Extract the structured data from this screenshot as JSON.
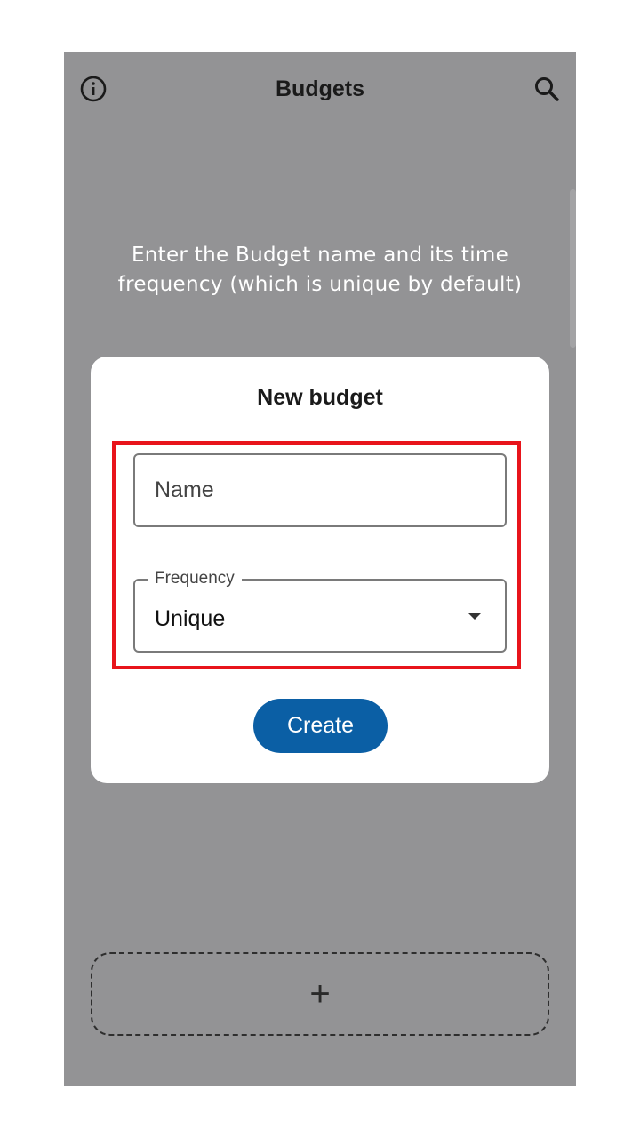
{
  "header": {
    "title": "Budgets",
    "info_icon": "info-icon",
    "search_icon": "search-icon"
  },
  "hint_text": "Enter the Budget name and its time frequency (which is unique by default)",
  "dialog": {
    "title": "New budget",
    "name_field": {
      "placeholder": "Name",
      "value": ""
    },
    "frequency_field": {
      "label": "Frequency",
      "value": "Unique",
      "dropdown_icon": "arrow-drop-down-icon"
    },
    "create_label": "Create"
  },
  "add_card": {
    "icon": "plus-icon",
    "symbol": "+"
  },
  "colors": {
    "overlay_background": "#939395",
    "dialog_background": "#ffffff",
    "primary_button": "#0b5fa5",
    "highlight_box": "#e8141b"
  }
}
